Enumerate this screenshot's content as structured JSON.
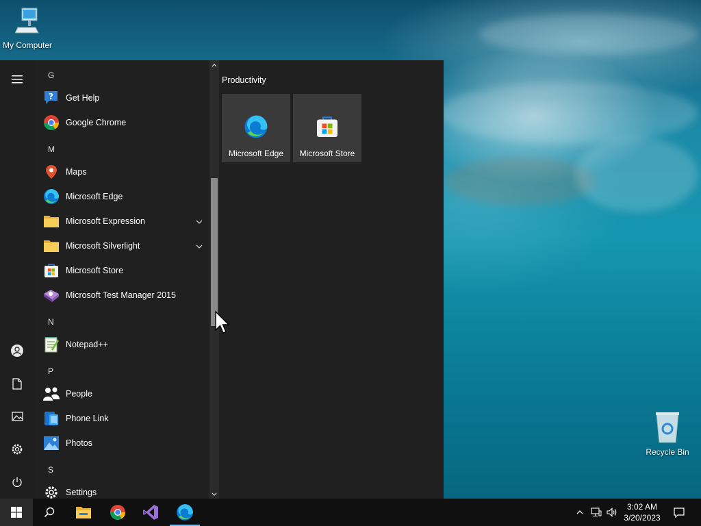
{
  "desktop": {
    "icons": [
      {
        "label": "My Computer"
      },
      {
        "label": "Recycle Bin"
      }
    ]
  },
  "start_menu": {
    "rail": {
      "items": [
        "menu-icon",
        "user-icon",
        "documents-icon",
        "pictures-icon",
        "settings-icon",
        "power-icon"
      ]
    },
    "apps": {
      "groups": [
        {
          "letter": "G",
          "items": [
            {
              "name": "Get Help",
              "icon": "get-help-icon"
            },
            {
              "name": "Google Chrome",
              "icon": "chrome-icon"
            }
          ]
        },
        {
          "letter": "M",
          "items": [
            {
              "name": "Maps",
              "icon": "maps-icon"
            },
            {
              "name": "Microsoft Edge",
              "icon": "edge-icon"
            },
            {
              "name": "Microsoft Expression",
              "icon": "folder-icon",
              "expandable": true
            },
            {
              "name": "Microsoft Silverlight",
              "icon": "folder-icon",
              "expandable": true
            },
            {
              "name": "Microsoft Store",
              "icon": "store-icon"
            },
            {
              "name": "Microsoft Test Manager 2015",
              "icon": "test-manager-icon"
            }
          ]
        },
        {
          "letter": "N",
          "items": [
            {
              "name": "Notepad++",
              "icon": "notepad-plus-plus-icon"
            }
          ]
        },
        {
          "letter": "P",
          "items": [
            {
              "name": "People",
              "icon": "people-icon"
            },
            {
              "name": "Phone Link",
              "icon": "phone-link-icon"
            },
            {
              "name": "Photos",
              "icon": "photos-icon"
            }
          ]
        },
        {
          "letter": "S",
          "items": [
            {
              "name": "Settings",
              "icon": "settings-icon"
            }
          ]
        }
      ]
    },
    "tiles": {
      "group_title": "Productivity",
      "items": [
        {
          "label": "Microsoft Edge",
          "icon": "edge-icon"
        },
        {
          "label": "Microsoft Store",
          "icon": "store-icon"
        }
      ]
    }
  },
  "taskbar": {
    "pinned": [
      "windows-start-icon",
      "search-icon",
      "file-explorer-icon",
      "chrome-icon",
      "visual-studio-icon",
      "edge-icon"
    ],
    "clock": {
      "time": "3:02 AM",
      "date": "3/20/2023"
    },
    "accent_color": "#76b9ed"
  }
}
